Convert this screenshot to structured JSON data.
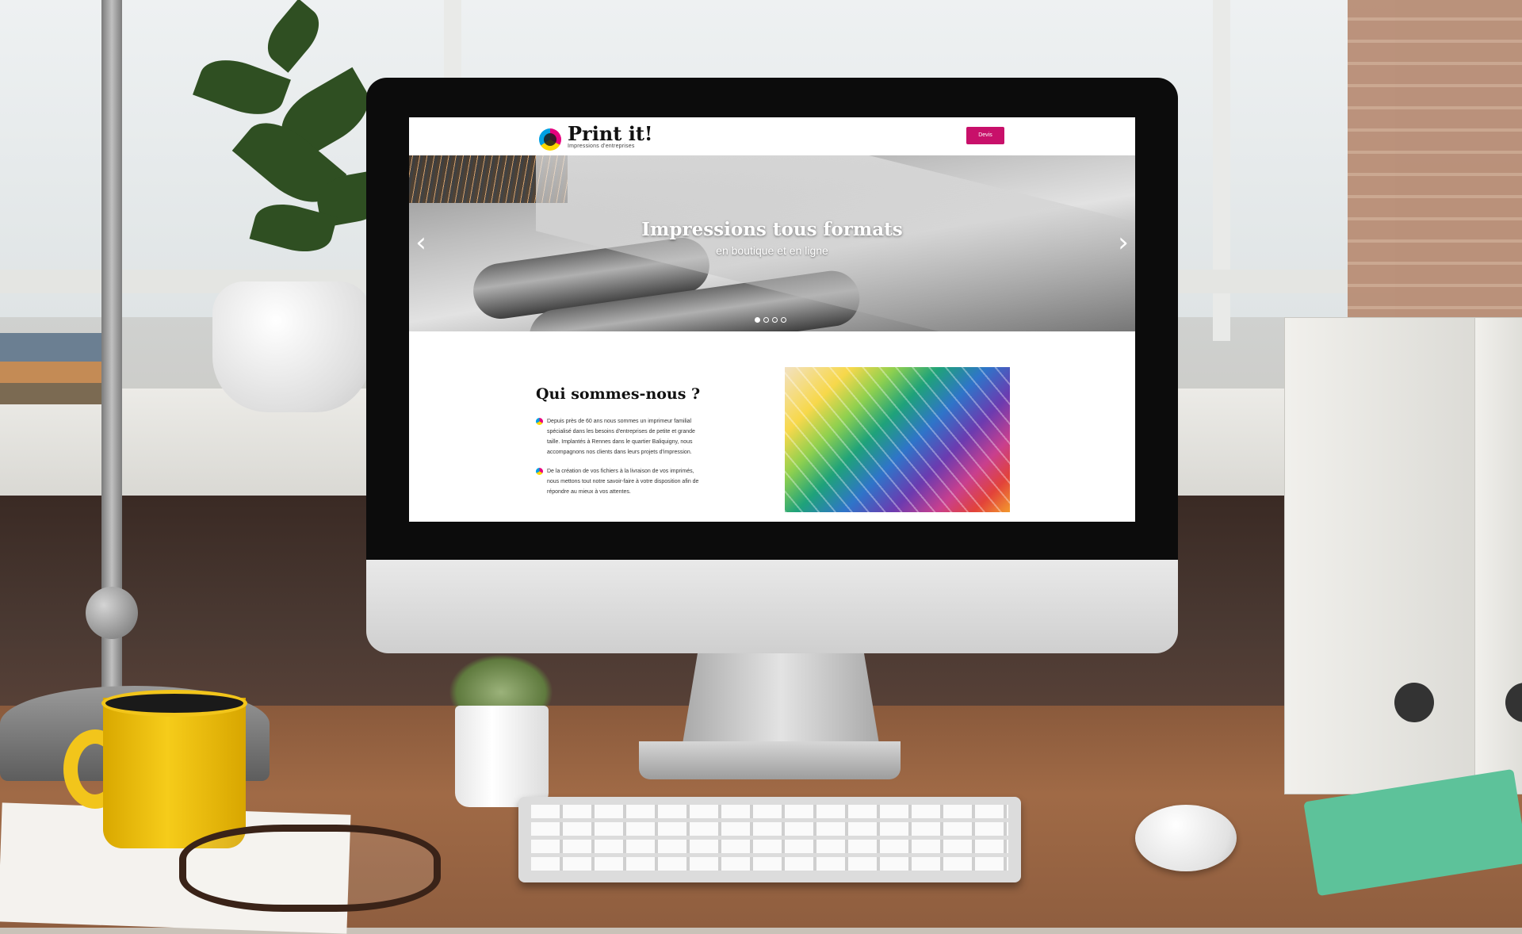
{
  "colors": {
    "brand_magenta": "#c8106a",
    "brand_yellow": "#ffd800",
    "brand_cyan": "#00a0e3",
    "text_dark": "#111111",
    "screen_bg": "#ffffff"
  },
  "site": {
    "logo": {
      "name": "Print it!",
      "tagline": "Impressions d'entreprises",
      "icon": "cmyk-circle-icon"
    },
    "header": {
      "cta_label": "Devis"
    },
    "hero": {
      "title": "Impressions tous formats",
      "subtitle": "en boutique et en ligne",
      "prev_icon": "chevron-left-icon",
      "next_icon": "chevron-right-icon",
      "slides_count": 4,
      "active_slide": 1
    },
    "about": {
      "title": "Qui sommes-nous ?",
      "bullets": [
        "Depuis près de 60 ans nous sommes un imprimeur familial spécialisé dans les besoins d'entreprises de petite et grande taille. Implantés à Rennes dans le quartier Baliquigny, nous accompagnons nos clients dans leurs projets d'impression.",
        "De la création de vos fichiers à la livraison de vos imprimés, nous mettons tout notre savoir-faire à votre disposition afin de répondre au mieux à vos attentes."
      ],
      "image": "color-swatch-fan-image"
    }
  }
}
